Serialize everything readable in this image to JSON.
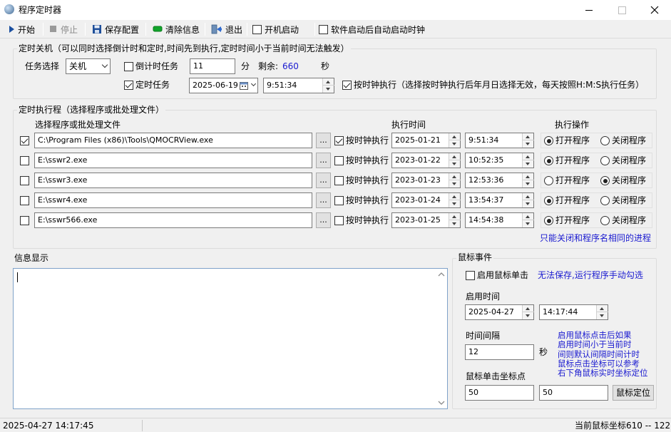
{
  "window": {
    "title": "程序定时器",
    "controls": [
      "minimize",
      "maximize",
      "close"
    ]
  },
  "toolbar": {
    "start": "开始",
    "stop": "停止",
    "save_config": "保存配置",
    "clear_info": "清除信息",
    "exit": "退出",
    "startup_label": "开机启动",
    "startup_checked": false,
    "auto_clock_label": "软件启动后自动启动时钟",
    "auto_clock_checked": false
  },
  "shutdown": {
    "legend": "定时关机（可以同时选择倒计时和定时,时间先到执行,定时时间小于当前时间无法触发）",
    "task_label": "任务选择",
    "task_value": "关机",
    "countdown_label": "倒计时任务",
    "countdown_checked": false,
    "countdown_value": "11",
    "minute_unit": "分",
    "remaining_label": "剩余:",
    "remaining_value": "660",
    "second_unit": "秒",
    "timed_label": "定时任务",
    "timed_checked": true,
    "date": "2025-06-19",
    "time": "9:51:34",
    "by_clock_label": "按时钟执行（选择按时钟执行后年月日选择无效，每天按照H:M:S执行任务）",
    "by_clock_checked": true
  },
  "schedule": {
    "legend": "定时执行程（选择程序或批处理文件）",
    "col_file": "选择程序或批处理文件",
    "col_time": "执行时间",
    "col_action": "执行操作",
    "browse_label": "...",
    "by_clock_label": "按时钟执行",
    "open_label": "打开程序",
    "close_label": "关闭程序",
    "rows": [
      {
        "enabled": true,
        "path": "C:\\Program Files (x86)\\Tools\\QMOCRView.exe",
        "by_clock": true,
        "date": "2025-01-21",
        "time": "9:51:34",
        "action": "open"
      },
      {
        "enabled": false,
        "path": "E:\\sswr2.exe",
        "by_clock": false,
        "date": "2023-01-22",
        "time": "10:52:35",
        "action": "open"
      },
      {
        "enabled": false,
        "path": "E:\\sswr3.exe",
        "by_clock": false,
        "date": "2023-01-23",
        "time": "12:53:36",
        "action": "close"
      },
      {
        "enabled": false,
        "path": "E:\\sswr4.exe",
        "by_clock": false,
        "date": "2023-01-24",
        "time": "13:54:37",
        "action": "open"
      },
      {
        "enabled": false,
        "path": "E:\\sswr566.exe",
        "by_clock": false,
        "date": "2023-01-25",
        "time": "14:54:38",
        "action": "open"
      }
    ],
    "note": "只能关闭和程序名相同的进程"
  },
  "info": {
    "legend": "信息显示",
    "content": ""
  },
  "mouse": {
    "legend": "鼠标事件",
    "enable_click_label": "启用鼠标单击",
    "enable_click_checked": false,
    "cannot_save_note": "无法保存,运行程序手动勾选",
    "enable_time_label": "启用时间",
    "date": "2025-04-27",
    "time": "14:17:44",
    "interval_label": "时间间隔",
    "interval_value": "12",
    "interval_unit": "秒",
    "hint_lines": [
      "启用鼠标点击后如果",
      "启用时间小于当前时",
      "间则默认间隔时间计时",
      "鼠标点击坐标可以参考",
      "右下角鼠标实时坐标定位"
    ],
    "coord_label": "鼠标单击坐标点",
    "coord_x": "50",
    "coord_y": "50",
    "locate_button": "鼠标定位"
  },
  "status": {
    "datetime": "2025-04-27 14:17:45",
    "mouse_coord": "当前鼠标坐标610 -- 122"
  },
  "colors": {
    "window_bg": "#f0f0f0",
    "note_blue": "#1a1ad0",
    "remaining_blue": "#1a1ad0"
  }
}
